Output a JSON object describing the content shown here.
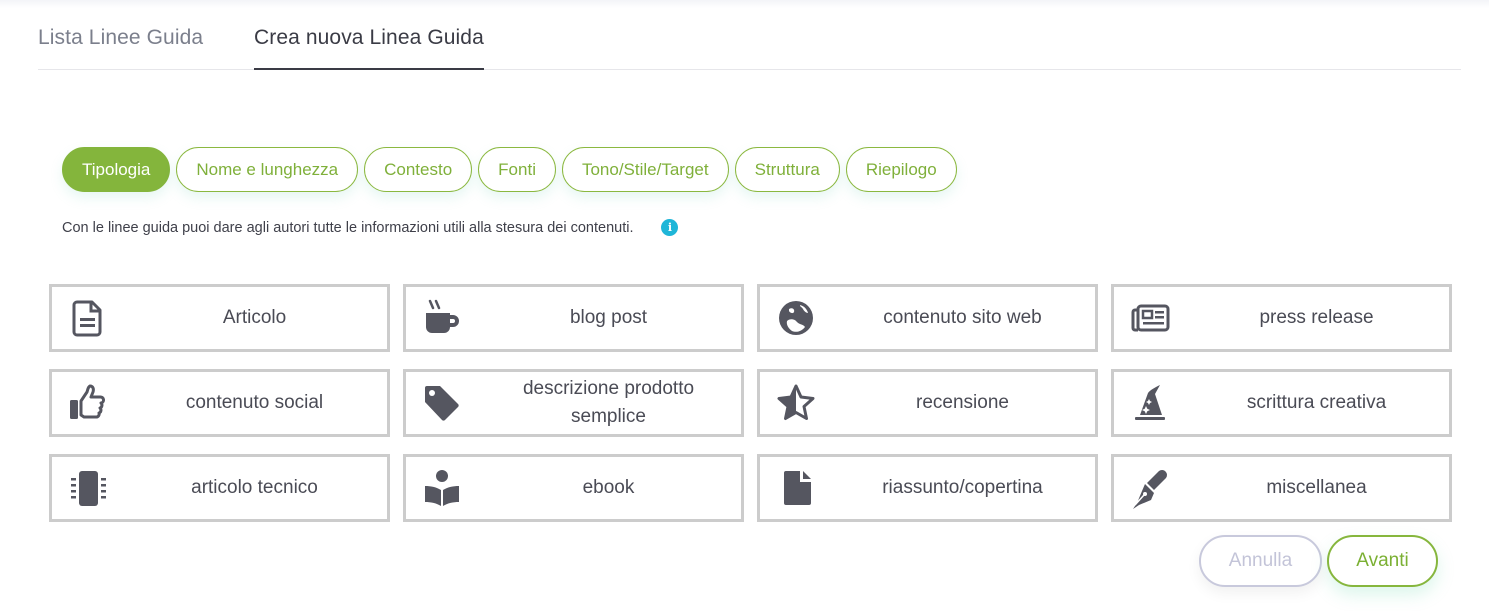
{
  "tabs": [
    {
      "label": "Lista Linee Guida",
      "active": false
    },
    {
      "label": "Crea nuova Linea Guida",
      "active": true
    }
  ],
  "steps": [
    {
      "label": "Tipologia",
      "active": true
    },
    {
      "label": "Nome e lunghezza",
      "active": false
    },
    {
      "label": "Contesto",
      "active": false
    },
    {
      "label": "Fonti",
      "active": false
    },
    {
      "label": "Tono/Stile/Target",
      "active": false
    },
    {
      "label": "Struttura",
      "active": false
    },
    {
      "label": "Riepilogo",
      "active": false
    }
  ],
  "info": {
    "text": "Con le linee guida puoi dare agli autori tutte le informazioni utili alla stesura dei contenuti.",
    "icon": "info-circle-icon",
    "icon_glyph": "i"
  },
  "types": [
    {
      "label": "Articolo",
      "icon": "file-lines-icon"
    },
    {
      "label": "blog post",
      "icon": "coffee-mug-icon"
    },
    {
      "label": "contenuto sito web",
      "icon": "globe-icon"
    },
    {
      "label": "press release",
      "icon": "newspaper-icon"
    },
    {
      "label": "contenuto social",
      "icon": "thumbs-up-icon"
    },
    {
      "label": "descrizione prodotto semplice",
      "icon": "tag-icon"
    },
    {
      "label": "recensione",
      "icon": "star-half-icon"
    },
    {
      "label": "scrittura creativa",
      "icon": "wizard-hat-icon"
    },
    {
      "label": "articolo tecnico",
      "icon": "microchip-icon"
    },
    {
      "label": "ebook",
      "icon": "book-reader-icon"
    },
    {
      "label": "riassunto/copertina",
      "icon": "file-icon"
    },
    {
      "label": "miscellanea",
      "icon": "fountain-pen-icon"
    }
  ],
  "actions": {
    "cancel_label": "Annulla",
    "next_label": "Avanti"
  },
  "colors": {
    "accent_green": "#84b53c",
    "info_blue": "#1fb6d8",
    "icon_gray": "#555660",
    "card_border": "#cccccc"
  }
}
